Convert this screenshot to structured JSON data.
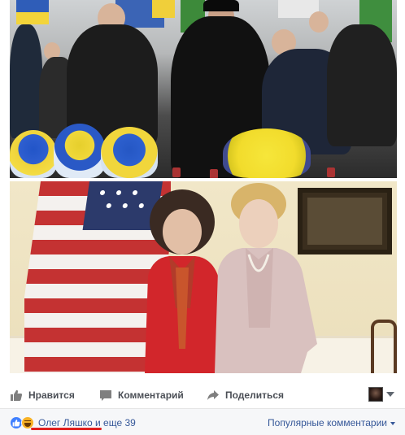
{
  "post": {
    "photos": [
      {
        "alt_label": ""
      },
      {
        "alt_label": ""
      }
    ]
  },
  "actions": {
    "like_label": "Нравится",
    "comment_label": "Комментарий",
    "share_label": "Поделиться"
  },
  "reactions": {
    "icons": [
      "like-icon",
      "haha-icon"
    ],
    "liker_name": "Олег Ляшко",
    "others_text": " и еще 39",
    "sort_label": "Популярные комментарии"
  },
  "colors": {
    "link_blue": "#365899",
    "action_gray": "#4b4f56",
    "like_blue": "#4080ff",
    "haha_yellow": "#f7b125",
    "highlight_red": "#e0201f"
  }
}
